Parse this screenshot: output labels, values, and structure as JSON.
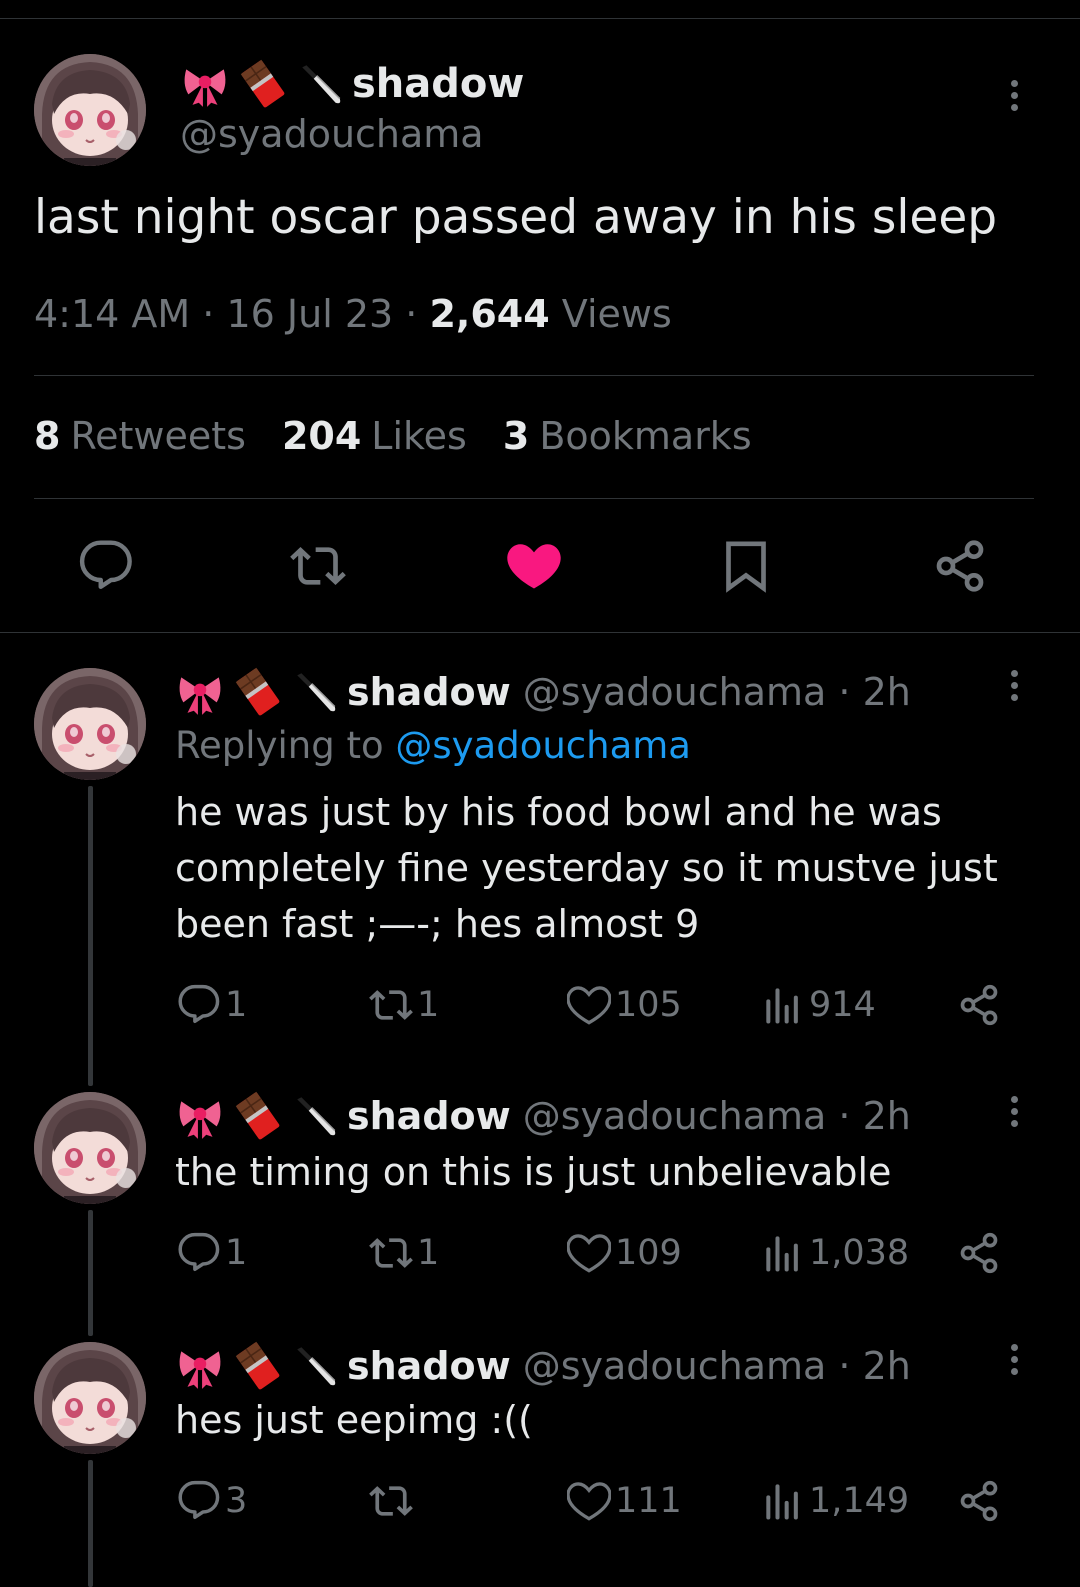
{
  "main_tweet": {
    "display_name": "shadow",
    "handle": "@syadouchama",
    "text": "last night oscar passed away in his sleep",
    "time": "4:14 AM",
    "sep1": "·",
    "date": "16 Jul 23",
    "sep2": "·",
    "views_count": "2,644",
    "views_label": "Views",
    "stats": {
      "retweets_count": "8",
      "retweets_label": "Retweets",
      "likes_count": "204",
      "likes_label": "Likes",
      "bookmarks_count": "3",
      "bookmarks_label": "Bookmarks"
    },
    "liked": true
  },
  "replies": [
    {
      "display_name": "shadow",
      "handle_time": "@syadouchama · 2h",
      "replying_prefix": "Replying to",
      "replying_to": "@syadouchama",
      "lines": [
        "he was just by his food bowl and he was",
        "completely fine yesterday so it mustve just",
        "been fast ;—-; hes almost 9"
      ],
      "reply_count": "1",
      "retweet_count": "1",
      "like_count": "105",
      "view_count": "914"
    },
    {
      "display_name": "shadow",
      "handle_time": "@syadouchama · 2h",
      "lines": [
        "the timing on this is just unbelievable"
      ],
      "reply_count": "1",
      "retweet_count": "1",
      "like_count": "109",
      "view_count": "1,038"
    },
    {
      "display_name": "shadow",
      "handle_time": "@syadouchama · 2h",
      "lines": [
        "hes just eepimg :(("
      ],
      "reply_count": "3",
      "retweet_count": "",
      "like_count": "111",
      "view_count": "1,149"
    }
  ],
  "colors": {
    "background": "#000000",
    "text": "#e7e9ea",
    "muted": "#71767b",
    "link": "#1d9bf0",
    "like": "#f91880",
    "divider": "#2f3336"
  },
  "icons": [
    "ribbon-emoji",
    "chocolate-emoji",
    "knife-emoji",
    "more-icon",
    "reply-icon",
    "retweet-icon",
    "heart-icon",
    "bookmark-icon",
    "share-icon",
    "views-icon"
  ]
}
